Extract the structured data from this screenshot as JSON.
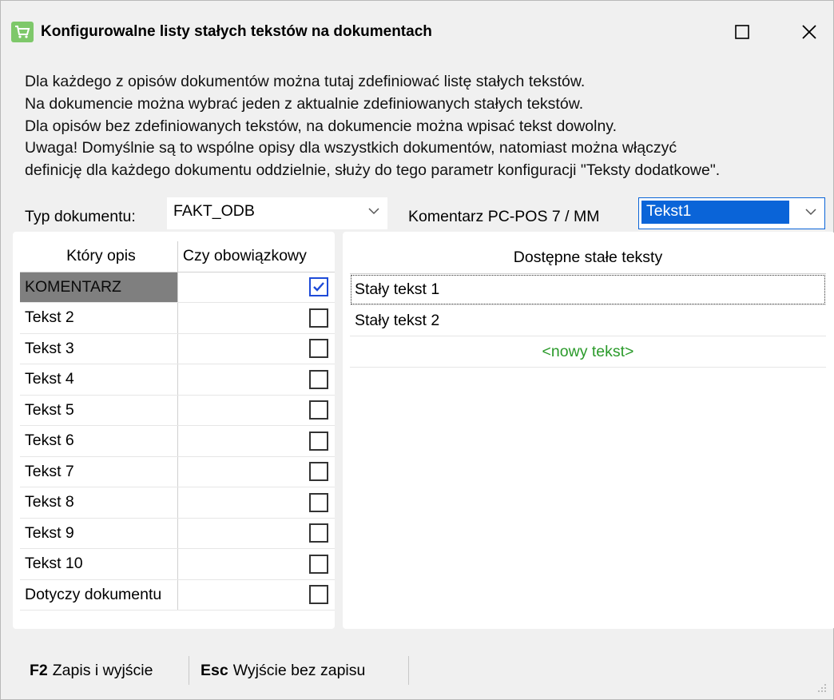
{
  "window": {
    "title": "Konfigurowalne listy stałych tekstów na dokumentach",
    "app_icon": "shopping-cart-icon",
    "maximize_icon": "maximize-icon",
    "close_icon": "close-icon"
  },
  "description": {
    "line1": "Dla każdego z opisów dokumentów można tutaj zdefiniować listę stałych tekstów.",
    "line2": "Na dokumencie można wybrać jeden z aktualnie zdefiniowanych stałych tekstów.",
    "line3": "Dla opisów bez zdefiniowanych tekstów, na dokumencie można wpisać tekst dowolny.",
    "line4": "Uwaga! Domyślnie są to wspólne opisy dla wszystkich dokumentów, natomiast można włączyć",
    "line5": "definicję dla każdego dokumentu oddzielnie, służy do tego parametr konfiguracji \"Teksty dodatkowe\"."
  },
  "filters": {
    "doc_type_label": "Typ dokumentu:",
    "doc_type_value": "FAKT_ODB",
    "comment_label": "Komentarz PC-POS 7 / MM",
    "comment_value": "Tekst1"
  },
  "left_table": {
    "headers": [
      "Który opis",
      "Czy obowiązkowy"
    ],
    "rows": [
      {
        "label": "KOMENTARZ",
        "checked": true
      },
      {
        "label": "Tekst 2",
        "checked": false
      },
      {
        "label": "Tekst 3",
        "checked": false
      },
      {
        "label": "Tekst 4",
        "checked": false
      },
      {
        "label": "Tekst 5",
        "checked": false
      },
      {
        "label": "Tekst 6",
        "checked": false
      },
      {
        "label": "Tekst 7",
        "checked": false
      },
      {
        "label": "Tekst 8",
        "checked": false
      },
      {
        "label": "Tekst 9",
        "checked": false
      },
      {
        "label": "Tekst 10",
        "checked": false
      },
      {
        "label": "Dotyczy dokumentu",
        "checked": false
      }
    ]
  },
  "right_table": {
    "header": "Dostępne stałe teksty",
    "rows": [
      "Stały tekst 1",
      "Stały tekst 2"
    ],
    "new_text": "<nowy tekst>"
  },
  "footer": {
    "save_key": "F2",
    "save_label": "Zapis i wyjście",
    "exit_key": "Esc",
    "exit_label": "Wyjście bez zapisu"
  },
  "colors": {
    "selected_row": "#7f7f7f",
    "combo_highlight": "#0a64d8",
    "new_text": "#2a9a2a",
    "checkmark": "#1e4bd8"
  }
}
